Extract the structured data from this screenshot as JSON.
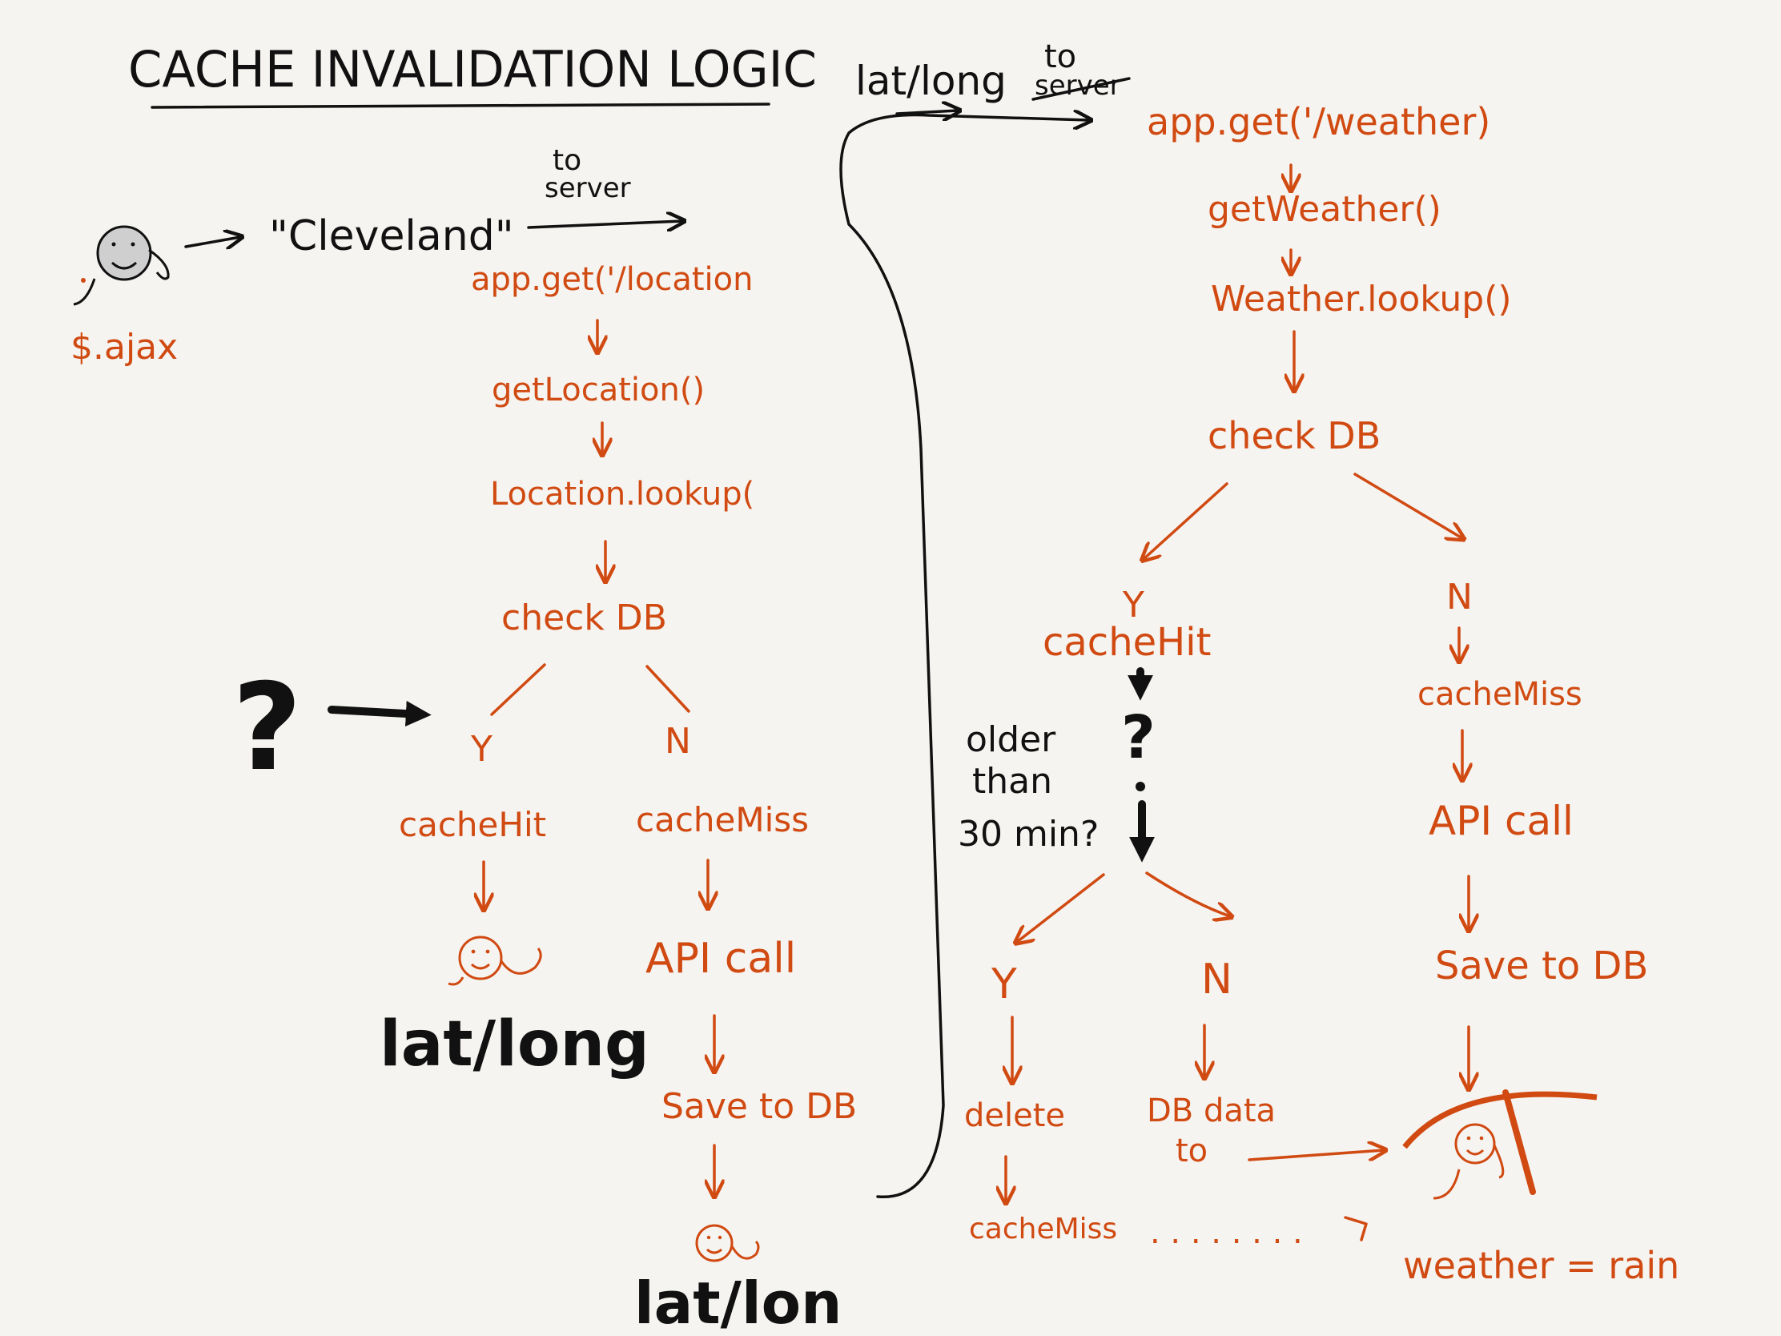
{
  "title": "CACHE INVALIDATION LOGIC",
  "colors": {
    "accent": "#d04a12",
    "ink": "#111111",
    "paper": "#f6f4f0",
    "face_fill": "#cfcfcf"
  },
  "left_flow": {
    "client_request": "\"Cleveland\"",
    "client_label": "$.ajax",
    "to_label": "to",
    "server_label": "server",
    "route": "app.get('/location",
    "handler": "getLocation()",
    "lookup": "Location.lookup(",
    "check": "check DB",
    "yes": "Y",
    "no": "N",
    "hit": "cacheHit",
    "miss": "cacheMiss",
    "hit_result": "lat/long",
    "api": "API call",
    "save": "Save to DB",
    "miss_result": "lat/lon",
    "question": "?"
  },
  "right_flow": {
    "link_label": "lat/long",
    "to_label": "to",
    "server_label": "server",
    "route": "app.get('/weather)",
    "handler": "getWeather()",
    "lookup": "Weather.lookup()",
    "check": "check DB",
    "yes": "Y",
    "no": "N",
    "hit": "cacheHit",
    "miss": "cacheMiss",
    "age_question": [
      "older",
      "than",
      "30 min?"
    ],
    "api": "API call",
    "save": "Save to DB",
    "stale_yes": "Y",
    "stale_no": "N",
    "delete": "delete",
    "db_data": [
      "DB data",
      "to"
    ],
    "stale_miss": "cacheMiss",
    "dots": ". . . . . . . .",
    "result": "weather = rain"
  }
}
